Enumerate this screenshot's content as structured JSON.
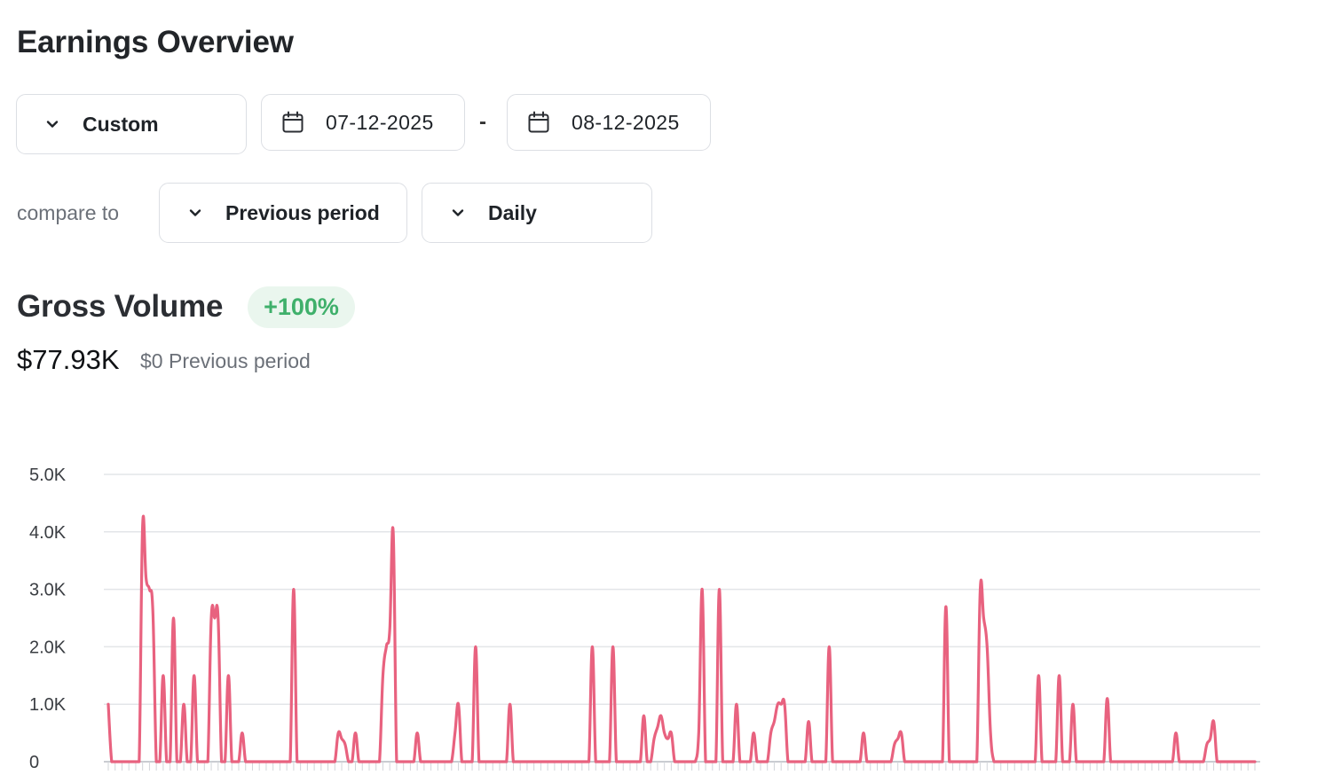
{
  "page": {
    "title": "Earnings Overview"
  },
  "filters": {
    "period": {
      "label": "Custom",
      "icon": "chevron-down-icon"
    },
    "date_from": {
      "value": "07-12-2025",
      "icon": "calendar-icon"
    },
    "separator": "-",
    "date_to": {
      "value": "08-12-2025",
      "icon": "calendar-icon"
    },
    "compare_label": "compare to",
    "compare": {
      "label": "Previous period",
      "icon": "chevron-down-icon"
    },
    "interval": {
      "label": "Daily",
      "icon": "chevron-down-icon"
    }
  },
  "metric": {
    "title": "Gross Volume",
    "change": "+100%",
    "value": "$77.93K",
    "previous": "$0 Previous period"
  },
  "colors": {
    "line": "#e8627f",
    "badge_bg": "#eaf6ee",
    "badge_text": "#3fb06b",
    "grid": "#e3e5e8"
  },
  "chart_data": {
    "type": "line",
    "y_tick_labels": [
      "0",
      "1.0K",
      "2.0K",
      "3.0K",
      "4.0K",
      "5.0K"
    ],
    "ylim": [
      0,
      5000
    ],
    "grid": true,
    "series": [
      {
        "color": "#e8627f",
        "values": [
          1000,
          0,
          0,
          0,
          0,
          0,
          0,
          0,
          0,
          0,
          4100,
          3200,
          3000,
          2600,
          0,
          0,
          1500,
          0,
          0,
          2500,
          0,
          0,
          1000,
          0,
          0,
          1500,
          0,
          0,
          0,
          0,
          2500,
          2500,
          2500,
          0,
          0,
          1500,
          0,
          0,
          0,
          500,
          0,
          0,
          0,
          0,
          0,
          0,
          0,
          0,
          0,
          0,
          0,
          0,
          0,
          0,
          3000,
          0,
          0,
          0,
          0,
          0,
          0,
          0,
          0,
          0,
          0,
          0,
          0,
          500,
          400,
          300,
          0,
          0,
          500,
          0,
          0,
          0,
          0,
          0,
          0,
          0,
          1500,
          2000,
          2300,
          4000,
          0,
          0,
          0,
          0,
          0,
          0,
          500,
          0,
          0,
          0,
          0,
          0,
          0,
          0,
          0,
          0,
          0,
          500,
          1000,
          0,
          0,
          0,
          0,
          2000,
          0,
          0,
          0,
          0,
          0,
          0,
          0,
          0,
          0,
          1000,
          0,
          0,
          0,
          0,
          0,
          0,
          0,
          0,
          0,
          0,
          0,
          0,
          0,
          0,
          0,
          0,
          0,
          0,
          0,
          0,
          0,
          0,
          0,
          2000,
          0,
          0,
          0,
          0,
          0,
          2000,
          0,
          0,
          0,
          0,
          0,
          0,
          0,
          0,
          800,
          0,
          0,
          400,
          600,
          800,
          500,
          400,
          500,
          0,
          0,
          0,
          0,
          0,
          0,
          0,
          500,
          3000,
          0,
          0,
          0,
          0,
          3000,
          0,
          0,
          0,
          0,
          1000,
          0,
          0,
          0,
          0,
          500,
          0,
          0,
          0,
          0,
          500,
          700,
          1000,
          1000,
          1000,
          0,
          0,
          0,
          0,
          0,
          0,
          700,
          0,
          0,
          0,
          0,
          0,
          2000,
          0,
          0,
          0,
          0,
          0,
          0,
          0,
          0,
          0,
          500,
          0,
          0,
          0,
          0,
          0,
          0,
          0,
          0,
          300,
          400,
          500,
          0,
          0,
          0,
          0,
          0,
          0,
          0,
          0,
          0,
          0,
          0,
          0,
          2700,
          0,
          0,
          0,
          0,
          0,
          0,
          0,
          0,
          0,
          3000,
          2500,
          2000,
          500,
          0,
          0,
          0,
          0,
          0,
          0,
          0,
          0,
          0,
          0,
          0,
          0,
          0,
          1500,
          0,
          0,
          0,
          0,
          0,
          1500,
          0,
          0,
          0,
          1000,
          0,
          0,
          0,
          0,
          0,
          0,
          0,
          0,
          0,
          1100,
          0,
          0,
          0,
          0,
          0,
          0,
          0,
          0,
          0,
          0,
          0,
          0,
          0,
          0,
          0,
          0,
          0,
          0,
          0,
          500,
          0,
          0,
          0,
          0,
          0,
          0,
          0,
          0,
          300,
          400,
          700,
          0,
          0,
          0,
          0,
          0,
          0,
          0,
          0,
          0,
          0,
          0,
          0
        ]
      }
    ]
  }
}
